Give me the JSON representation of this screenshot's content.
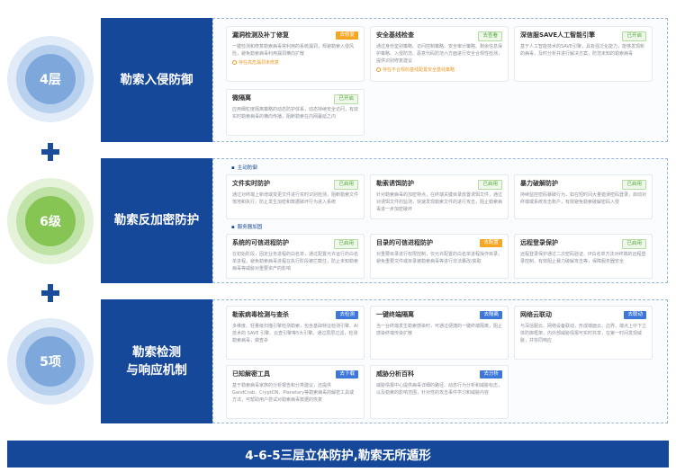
{
  "layers": [
    {
      "badge": "4层",
      "title": "勒索入侵防御",
      "cards": [
        {
          "title": "漏洞检测及补丁修复",
          "btn": "去修复",
          "desc": "一键检测和修复勒索病毒常利用的系统漏洞，规避勒索入侵风险，避免勒索病毒利用漏洞横向扩散",
          "note": "存在高危漏洞未修复"
        },
        {
          "title": "安全基线检查",
          "btn": "去查看",
          "desc": "通过身份鉴别策略、访问控制策略、安全审计策略、剩余信息保护策略、入侵防范、恶意代码防范六方面进行安全合规性检测，提供识别修复建议",
          "note": "存在不合规的基线配置安全基线策略"
        },
        {
          "title": "深信服SAVE人工智能引擎",
          "btn": "已开启",
          "desc": "基于人工智能技术的SAVE引擎，具有强泛化能力，能够发现新的病毒，及时分析并进行解决方案，防范未知的勒索病毒"
        },
        {
          "title": "微隔离",
          "btn": "已开启",
          "desc": "应用细粒度隔离策略的动态防护体系，动态持续安全访问，有效实时勒索病毒的横向传播，阻断勒索在内网蔓延之内"
        }
      ]
    },
    {
      "badge": "6级",
      "title": "勒索反加密防护",
      "groups": [
        {
          "label": "主动防御",
          "cards": [
            {
              "title": "文件实时防护",
              "btn": "已启用",
              "desc": "通过对终端上新增或变更文件进行实时识别检测，阻断勒索文件落地和执行，防止发生加密和数据破坏行为进入系统"
            },
            {
              "title": "勒索诱饵防护",
              "btn": "已启用",
              "desc": "针对勒索病毒的加密特点，在终端关键目录放置诱饵文件，通过对诱饵文件的监测，快速发现勒索文件的进行攻击，阻止勒索病毒进一步加密破坏"
            },
            {
              "title": "暴力破解防护",
              "btn": "已启用",
              "desc": "持续监控密码暴破行为，如在短时间大量错误密码登录，启动对终端或系统攻击账户，有效避免勒索破解密码入侵"
            }
          ]
        },
        {
          "label": "服务器加固",
          "cards": [
            {
              "title": "系统的可信进程防护",
              "btn": "已启用",
              "desc": "在初始阶段，固定业务进程的白名单，通过配置允许运行的白名单进程，避免勒索病毒进程在执行阶段被拦截住，防止未知勒索病毒等威胁对重要资产的影响"
            },
            {
              "title": "目录的可信进程防护",
              "btn": "去配置",
              "desc": "对重要目录进行权限控制，仅允许配置的白名单进程操作目录，避免重要文件或目录被勒索病毒等进行非法篡改/获取"
            },
            {
              "title": "远程登录保护",
              "btn": "已启用",
              "desc": "远程登录保护通过二次密码验证、IP白名单方法对终端的远程登录控制、有效阻止暴力破解攻击等，保障服务器安全"
            }
          ]
        }
      ]
    },
    {
      "badge": "5项",
      "title_line1": "勒索检测",
      "title_line2": "与响应机制",
      "cards": [
        {
          "title": "勒索病毒检测与查杀",
          "btn": "去检测",
          "desc": "多维度、轻量级扫描引擎检测勒索，包含基础特征检测引擎、AI 技术的 SAVE 引擎、云查引擎等5大引擎。通过层层过滤，检测勒索病毒，做查杀"
        },
        {
          "title": "一键终端隔离",
          "btn": "去隔离",
          "desc": "当一台终端发生勒索感染时，可通过便捷的一键终端隔离，阻止感染终端传染扩散"
        },
        {
          "title": "网络云联动",
          "btn": "去联动",
          "desc": "与深信服云、网络设备联动，形成端面云、边界、端点上中下立体防御框架，内外部威胁情报可实时共享，在第一时间发现威胁，并协同响应"
        },
        {
          "title": "已知解密工具",
          "btn": "去下载",
          "desc": "基于勒索病毒家族的分析报告和分类建议，还提供GandCrab、CryptON、Planetary等勒索病毒的解密工具或方法，可帮助用户尝试对勒索病毒数据的恢复"
        },
        {
          "title": "威胁分析百科",
          "btn": "去分析",
          "desc": "威胁情报中心提供病毒详细的路径、动态行为分析和威胁标志，以及勒索的影响范围，针对性的攻击事件学习和威胁内容"
        }
      ]
    }
  ],
  "footer": "4-6-5三层立体防护,勒索无所遁形",
  "colors": {
    "primary": "#16489a",
    "accent_orange": "#f5a623",
    "accent_green": "#52a83a",
    "button_blue": "#3d78d8"
  },
  "icons": [
    "plus-icon",
    "warning-circle-icon"
  ]
}
